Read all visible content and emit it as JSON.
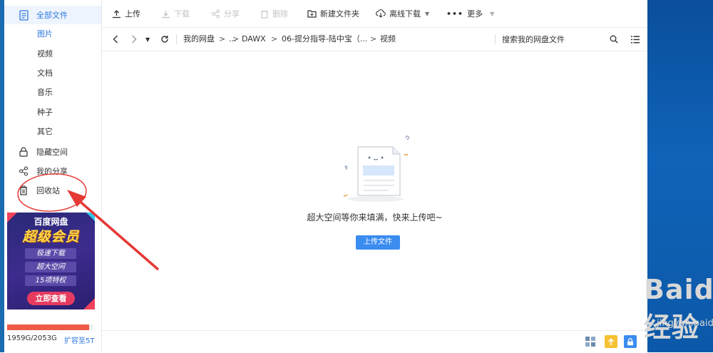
{
  "sidebar": {
    "all_files": "全部文件",
    "categories": [
      "图片",
      "视频",
      "文档",
      "音乐",
      "种子",
      "其它"
    ],
    "hidden_space": "隐藏空间",
    "my_share": "我的分享",
    "recycle_bin": "回收站",
    "ad": {
      "brand": "百度网盘",
      "headline": "超级会员",
      "features": [
        "极速下载",
        "超大空间",
        "15项特权"
      ],
      "cta": "立即查看"
    },
    "quota": {
      "text": "1959G/2053G",
      "used_fraction": 0.954,
      "upgrade": "扩容至5T"
    }
  },
  "toolbar": {
    "upload": "上传",
    "download": "下载",
    "share": "分享",
    "delete": "删除",
    "new_folder": "新建文件夹",
    "offline_download": "离线下载",
    "more": "更多"
  },
  "navbar": {
    "breadcrumbs": [
      "我的网盘",
      "...",
      "DAWX",
      "06-提分指导-陆中宝（...",
      "视频"
    ],
    "separator": ">",
    "search_placeholder": "搜索我的网盘文件"
  },
  "empty_state": {
    "message": "超大空间等你来填满，快来上传吧~",
    "upload_button": "上传文件"
  },
  "watermark": {
    "text": "Baidu经验",
    "url": "jingyan.baidu.com"
  },
  "colors": {
    "accent": "#3b8cf0",
    "annotation": "#e53935",
    "quota_fill": "#ef5a47",
    "desktop": "#0f63b8"
  }
}
